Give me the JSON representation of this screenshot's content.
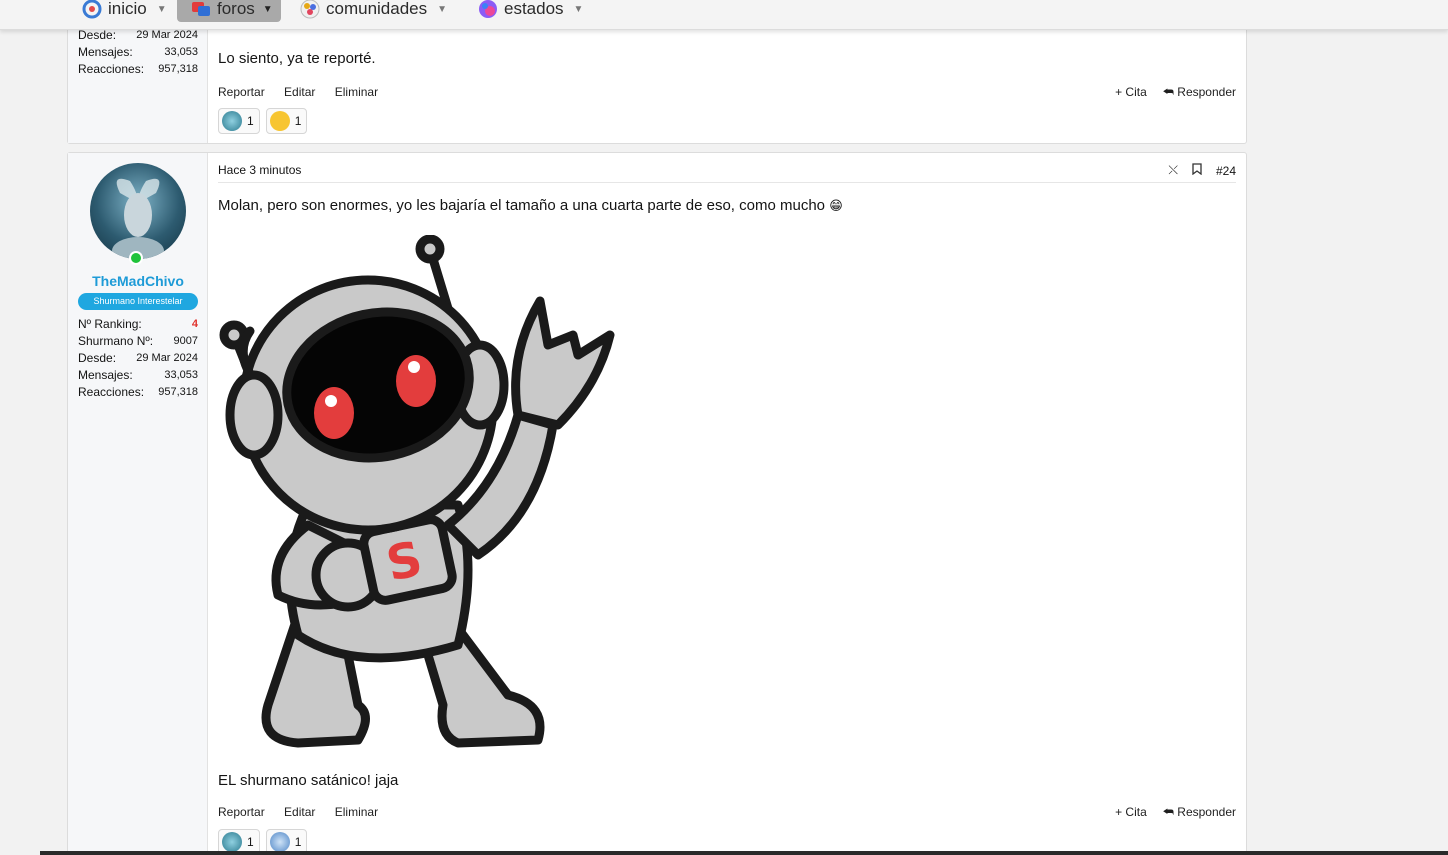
{
  "nav": [
    {
      "label": "inicio",
      "icon": "inicio-logo-icon"
    },
    {
      "label": "foros",
      "icon": "foros-icon"
    },
    {
      "label": "comunidades",
      "icon": "comunidades-icon"
    },
    {
      "label": "estados",
      "icon": "estados-icon"
    }
  ],
  "post1": {
    "stats": [
      {
        "k": "Desde:",
        "v": "29 Mar 2024"
      },
      {
        "k": "Mensajes:",
        "v": "33,053"
      },
      {
        "k": "Reacciones:",
        "v": "957,318"
      }
    ],
    "text": "Lo siento, ya te reporté.",
    "actions": {
      "report": "Reportar",
      "edit": "Editar",
      "delete": "Eliminar",
      "quote": "+ Cita",
      "reply": "Responder"
    },
    "reactions": [
      {
        "count": "1"
      },
      {
        "count": "1"
      }
    ]
  },
  "post2": {
    "time": "Hace 3 minutos",
    "number": "#24",
    "user": {
      "name": "TheMadChivo",
      "title": "Shurmano Interestelar"
    },
    "stats": [
      {
        "k": "Nº Ranking:",
        "v": "4"
      },
      {
        "k": "Shurmano Nº:",
        "v": "9007"
      },
      {
        "k": "Desde:",
        "v": "29 Mar 2024"
      },
      {
        "k": "Mensajes:",
        "v": "33,053"
      },
      {
        "k": "Reacciones:",
        "v": "957,318"
      }
    ],
    "text": "Molan, pero son enormes, yo les bajaría el tamaño a una cuarta parte de eso, como mucho",
    "emoji": "😁",
    "image_letter": "S",
    "footer_text": "EL shurmano satánico! jaja",
    "actions": {
      "report": "Reportar",
      "edit": "Editar",
      "delete": "Eliminar",
      "quote": "+ Cita",
      "reply": "Responder"
    },
    "reactions": [
      {
        "count": "1"
      },
      {
        "count": "1"
      }
    ]
  }
}
